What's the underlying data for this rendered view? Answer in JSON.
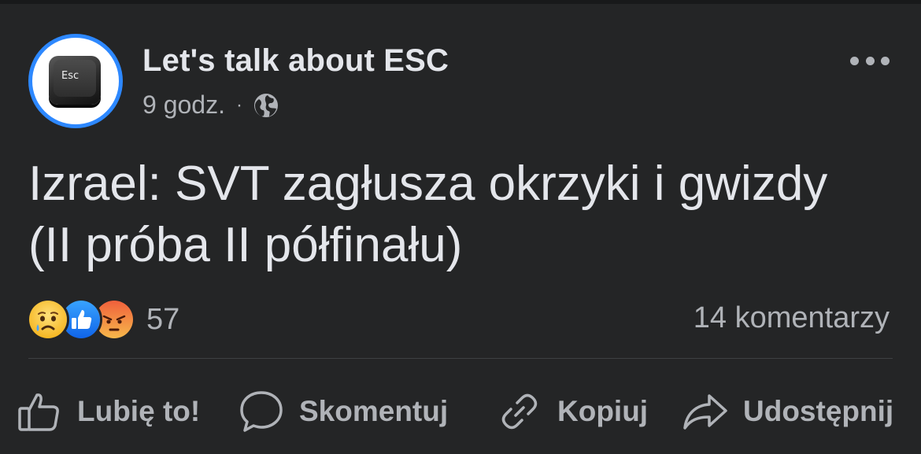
{
  "post": {
    "page_name": "Let's talk about ESC",
    "avatar_key_label": "Esc",
    "time": "9 godz.",
    "separator": "·",
    "privacy_icon": "globe-icon",
    "more_icon": "more-horizontal-icon",
    "text_line1": "Izrael: SVT zagłusza okrzyki i gwizdy",
    "text_line2": "(II próba II półfinału)"
  },
  "reactions": {
    "icons": [
      "sad-reaction-icon",
      "like-reaction-icon",
      "angry-reaction-icon"
    ],
    "count": "57"
  },
  "comments_label": "14 komentarzy",
  "actions": {
    "like": {
      "label": "Lubię to!",
      "icon": "thumbs-up-icon"
    },
    "comment": {
      "label": "Skomentuj",
      "icon": "comment-bubble-icon"
    },
    "copy": {
      "label": "Kopiuj",
      "icon": "link-icon"
    },
    "share": {
      "label": "Udostępnij",
      "icon": "share-arrow-icon"
    }
  },
  "colors": {
    "background": "#242526",
    "text_primary": "#e4e6eb",
    "text_secondary": "#b0b3b8",
    "avatar_ring": "#2d88ff",
    "like_blue": "#1877f2"
  }
}
